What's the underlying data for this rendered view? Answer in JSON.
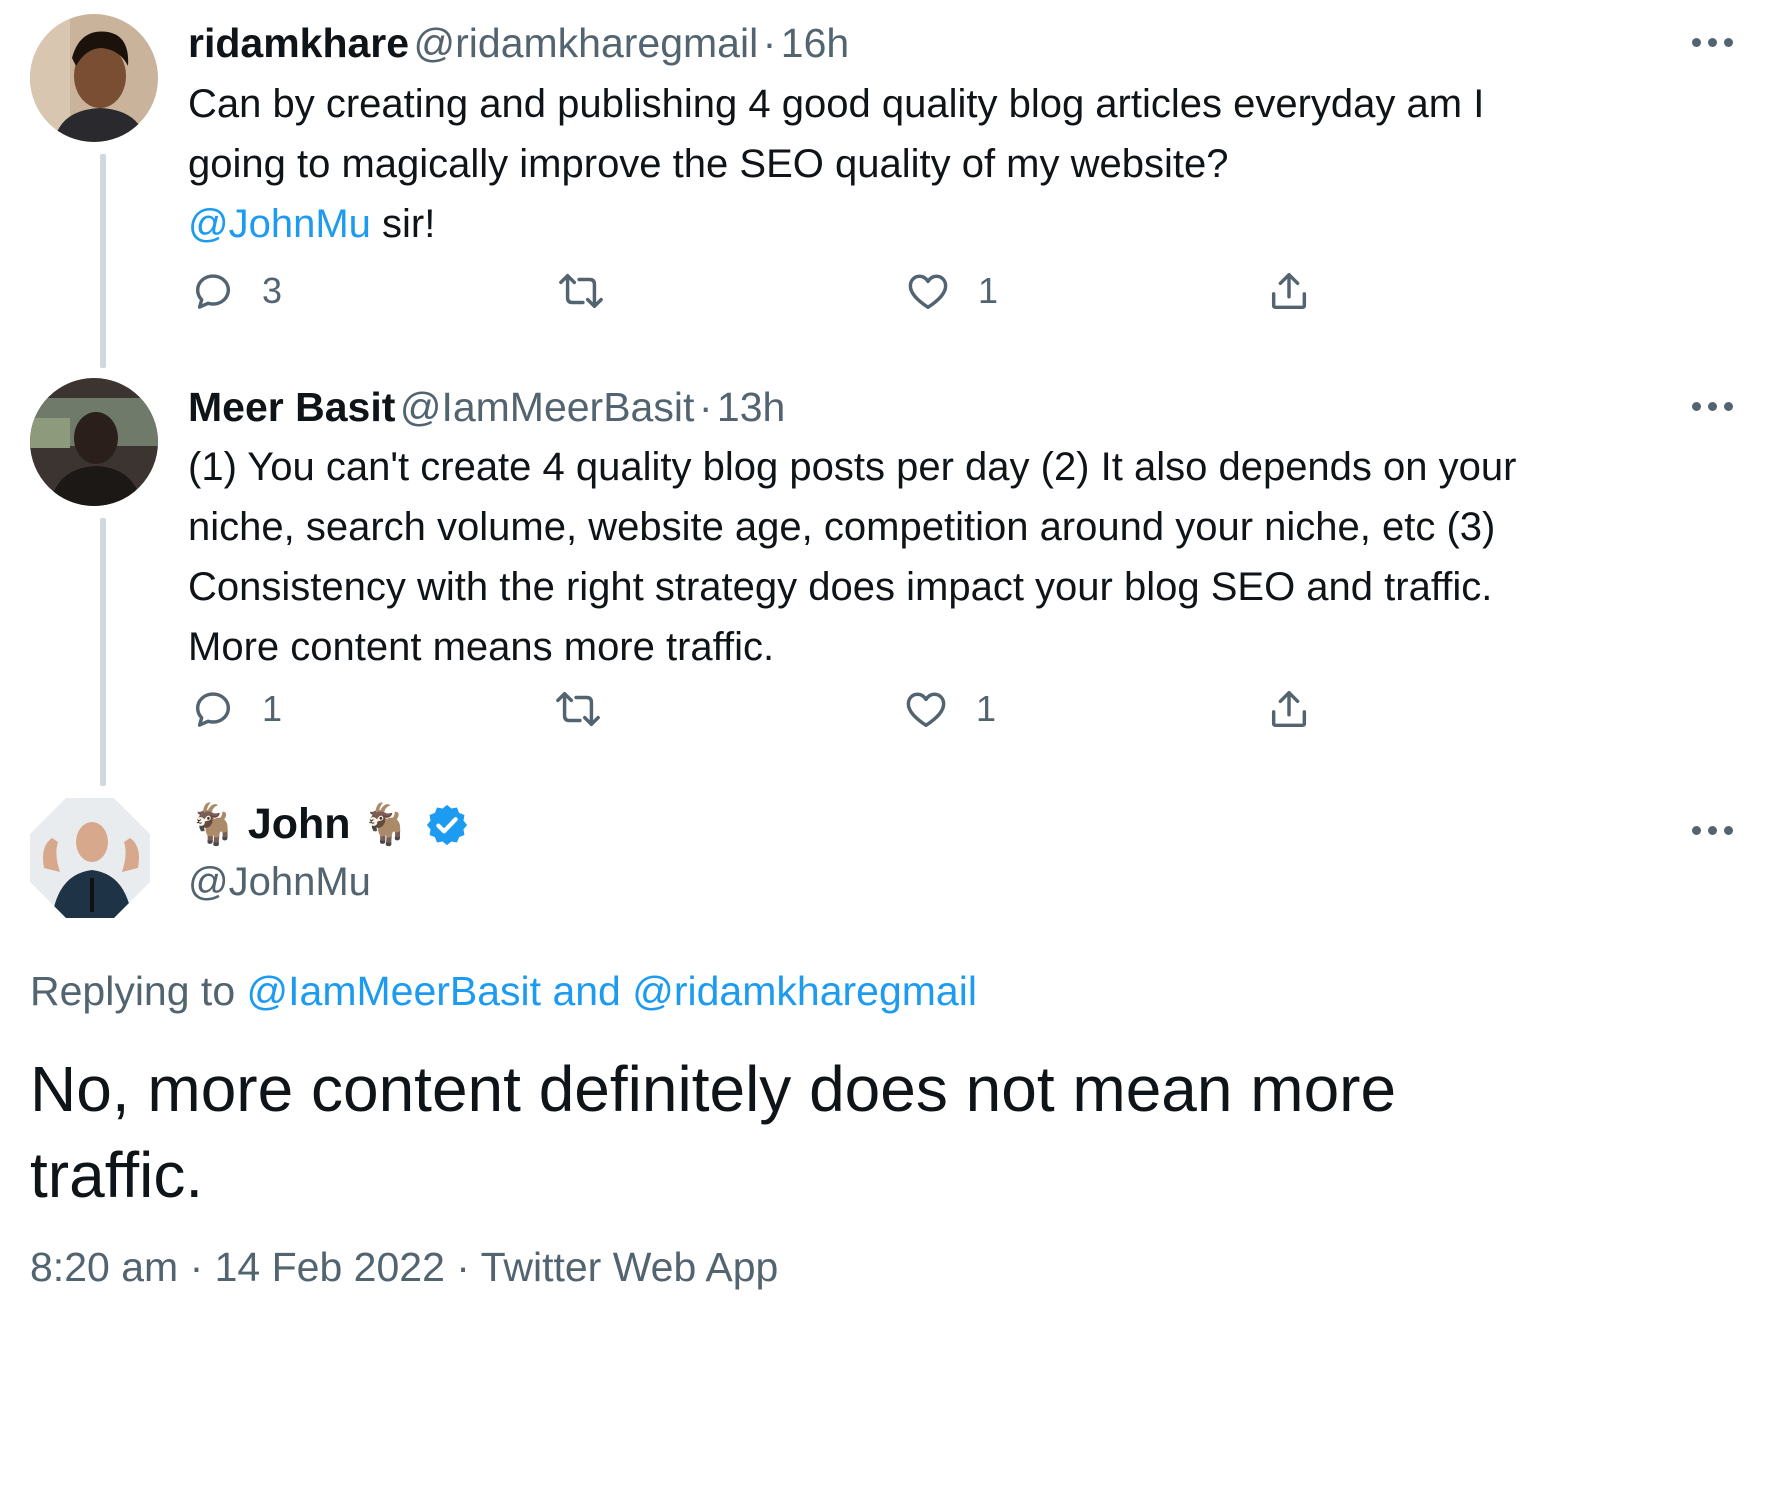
{
  "tweets": [
    {
      "name": "ridamkhare",
      "handle": "@ridamkharegmail",
      "time": "16h",
      "text": "Can by creating and publishing 4 good quality blog articles everyday am I going to magically improve the SEO quality of my website?",
      "mention": "@JohnMu",
      "text_after": " sir!",
      "replies": "3",
      "likes": "1"
    },
    {
      "name": "Meer Basit",
      "handle": "@IamMeerBasit",
      "time": "13h",
      "text": "(1) You can't create 4 quality blog posts per day (2) It also depends on your niche, search volume, website age, competition around your niche, etc (3) Consistency with the right strategy does impact your blog SEO and traffic. More content means more traffic.",
      "replies": "1",
      "likes": "1"
    }
  ],
  "main_tweet": {
    "name": "John",
    "goat_emoji": "🐐",
    "handle": "@JohnMu",
    "replying_prefix": "Replying to",
    "replying_handles": "@IamMeerBasit and @ridamkharegmail",
    "text": "No, more content definitely does not mean more traffic.",
    "time": "8:20 am",
    "date": "14 Feb 2022",
    "source": "Twitter Web App"
  },
  "separator": "·",
  "colors": {
    "text": "#0f1419",
    "secondary": "#536471",
    "link": "#1d9bf0",
    "thread_line": "#cfd9de"
  },
  "icons": [
    "reply-icon",
    "retweet-icon",
    "like-icon",
    "share-icon",
    "more-icon",
    "verified-badge-icon"
  ]
}
